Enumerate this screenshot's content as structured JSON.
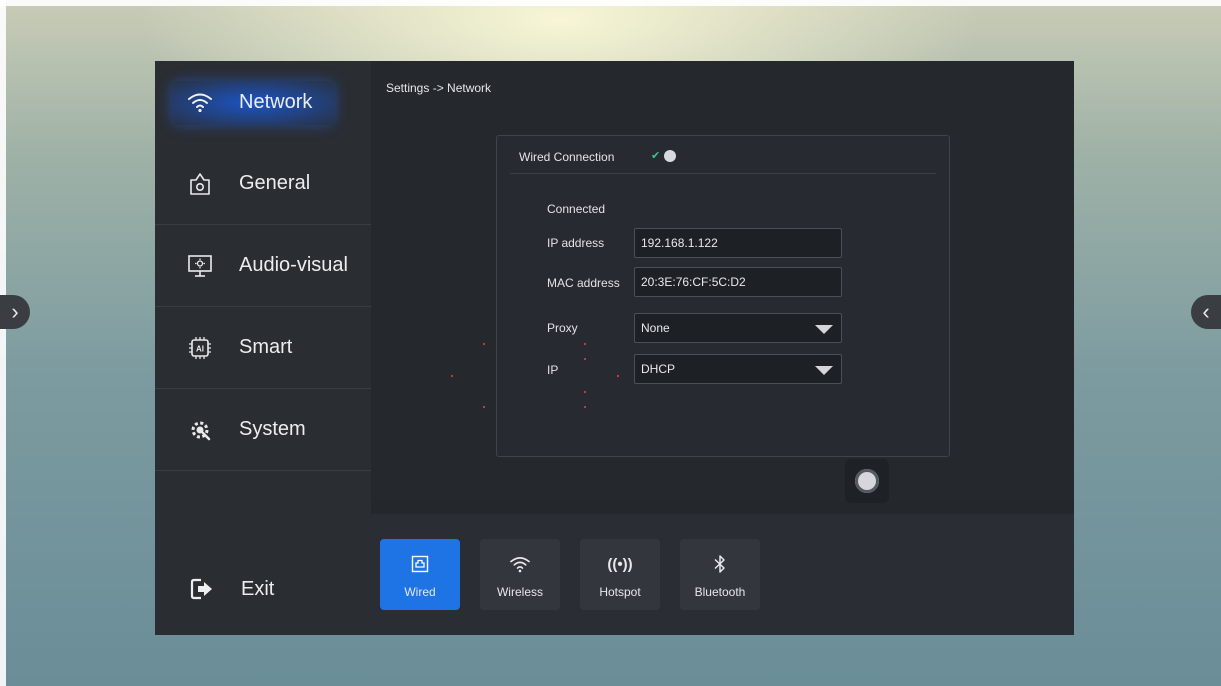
{
  "breadcrumb": "Settings -> Network",
  "sidebar": {
    "items": [
      {
        "label": "Network",
        "icon": "wifi-icon",
        "active": true
      },
      {
        "label": "General",
        "icon": "gear-icon",
        "active": false
      },
      {
        "label": "Audio-visual",
        "icon": "monitor-icon",
        "active": false
      },
      {
        "label": "Smart",
        "icon": "ai-chip-icon",
        "active": false
      },
      {
        "label": "System",
        "icon": "system-gear-icon",
        "active": false
      }
    ],
    "exit_label": "Exit"
  },
  "wired": {
    "title": "Wired Connection",
    "toggle_on": true,
    "status": "Connected",
    "ip_label": "IP address",
    "ip_value": "192.168.1.122",
    "mac_label": "MAC address",
    "mac_value": "20:3E:76:CF:5C:D2",
    "proxy_label": "Proxy",
    "proxy_value": "None",
    "ip_mode_label": "IP",
    "ip_mode_value": "DHCP"
  },
  "tabs": [
    {
      "label": "Wired",
      "icon": "ethernet-icon",
      "active": true
    },
    {
      "label": "Wireless",
      "icon": "wifi-icon",
      "active": false
    },
    {
      "label": "Hotspot",
      "icon": "hotspot-icon",
      "active": false
    },
    {
      "label": "Bluetooth",
      "icon": "bluetooth-icon",
      "active": false
    }
  ],
  "colors": {
    "accent": "#1f74e5",
    "toggle_check": "#3fc08f",
    "panel_bg": "#24272c"
  }
}
